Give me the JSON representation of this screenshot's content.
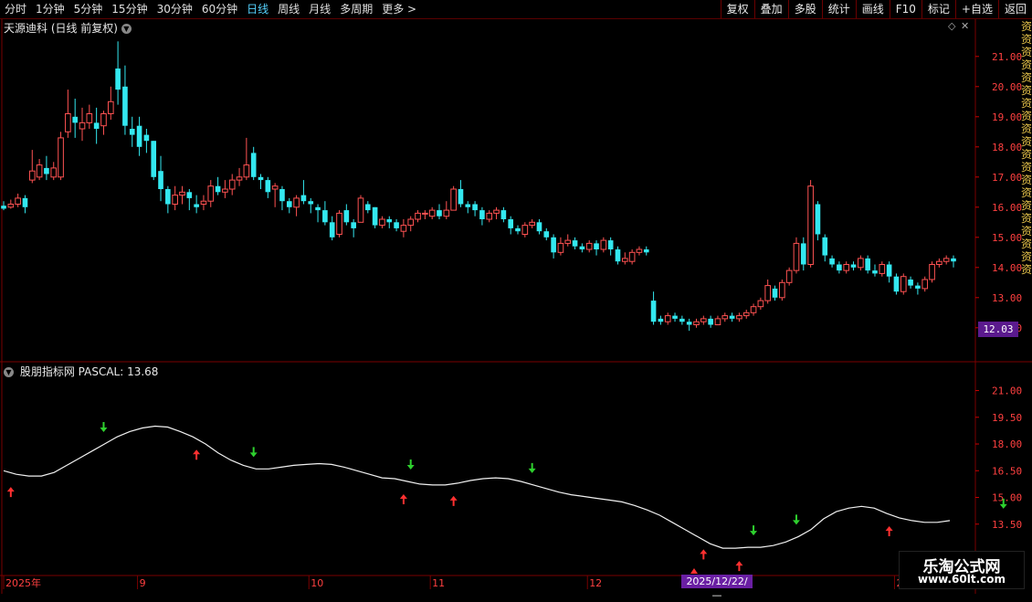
{
  "periods": [
    "分时",
    "1分钟",
    "5分钟",
    "15分钟",
    "30分钟",
    "60分钟",
    "日线",
    "周线",
    "月线",
    "多周期",
    "更多 >"
  ],
  "active_period": "日线",
  "tools": [
    "复权",
    "叠加",
    "多股",
    "统计",
    "画线",
    "F10",
    "标记",
    "+自选",
    "返回"
  ],
  "stock_title": "天源迪科 (日线 前复权)",
  "indicator_title": "股朋指标网 PASCAL: 13.68",
  "right_strip": "资资资资资资资资资资资资资资资资资资资资",
  "current_price": "12.03",
  "cursor_date": "2025/12/22/—",
  "watermark": {
    "line1": "乐淘公式网",
    "line2": "www.60lt.com"
  },
  "main_axis": {
    "min": 11.6,
    "max": 21.6,
    "ticks": [
      "21.00",
      "20.00",
      "19.00",
      "18.00",
      "17.00",
      "16.00",
      "15.00",
      "14.00",
      "13.00",
      "12.00"
    ]
  },
  "ind_axis": {
    "min": 12.0,
    "max": 21.9,
    "ticks": [
      "21.00",
      "19.50",
      "18.00",
      "16.50",
      "15.00",
      "13.50"
    ]
  },
  "x_labels": [
    {
      "text": "2025年",
      "i": 0
    },
    {
      "text": "9",
      "i": 24
    },
    {
      "text": "10",
      "i": 53
    },
    {
      "text": "11",
      "i": 75
    },
    {
      "text": "12",
      "i": 101
    },
    {
      "text": "2",
      "i": 155
    }
  ],
  "colors": {
    "up": "#ff5252",
    "down": "#33e8f0",
    "line": "#f0f0f0",
    "buy": "#ff3030",
    "sell": "#2ed02e",
    "grid": "#7a0000"
  },
  "chart_data": {
    "type": "candlestick",
    "candles": [
      [
        16.05,
        15.95,
        16.2,
        15.9
      ],
      [
        16.0,
        16.1,
        16.25,
        15.95
      ],
      [
        16.1,
        16.3,
        16.45,
        16.0
      ],
      [
        16.3,
        16.0,
        16.4,
        15.8
      ],
      [
        16.9,
        17.2,
        17.9,
        16.8
      ],
      [
        17.0,
        17.4,
        17.6,
        16.9
      ],
      [
        17.3,
        17.1,
        17.7,
        16.9
      ],
      [
        17.0,
        17.3,
        17.5,
        16.9
      ],
      [
        17.0,
        18.3,
        18.5,
        16.9
      ],
      [
        18.5,
        19.1,
        19.9,
        18.3
      ],
      [
        19.0,
        18.8,
        19.6,
        18.3
      ],
      [
        18.6,
        18.8,
        19.3,
        18.2
      ],
      [
        18.8,
        19.1,
        19.4,
        18.6
      ],
      [
        18.8,
        18.6,
        19.3,
        18.1
      ],
      [
        18.7,
        19.1,
        19.2,
        18.4
      ],
      [
        19.1,
        19.5,
        20.0,
        18.9
      ],
      [
        20.6,
        19.9,
        21.5,
        19.4
      ],
      [
        20.0,
        18.7,
        20.7,
        18.4
      ],
      [
        18.6,
        18.4,
        19.0,
        18.0
      ],
      [
        18.7,
        18.0,
        19.0,
        17.7
      ],
      [
        18.4,
        18.2,
        18.6,
        17.8
      ],
      [
        18.2,
        17.0,
        18.2,
        16.9
      ],
      [
        17.2,
        16.6,
        17.7,
        16.2
      ],
      [
        16.6,
        16.1,
        16.7,
        15.8
      ],
      [
        16.1,
        16.4,
        16.7,
        15.9
      ],
      [
        16.4,
        16.5,
        16.7,
        16.1
      ],
      [
        16.5,
        16.3,
        16.6,
        15.9
      ],
      [
        16.1,
        16.0,
        16.4,
        15.8
      ],
      [
        16.1,
        16.2,
        16.4,
        15.9
      ],
      [
        16.2,
        16.7,
        16.9,
        16.0
      ],
      [
        16.7,
        16.5,
        17.0,
        16.4
      ],
      [
        16.5,
        16.6,
        16.9,
        16.3
      ],
      [
        16.6,
        16.9,
        17.1,
        16.4
      ],
      [
        16.9,
        17.0,
        17.3,
        16.7
      ],
      [
        17.0,
        17.4,
        18.3,
        16.9
      ],
      [
        17.8,
        17.0,
        18.0,
        16.9
      ],
      [
        17.0,
        16.9,
        17.1,
        16.6
      ],
      [
        16.9,
        16.5,
        17.0,
        16.3
      ],
      [
        16.6,
        16.7,
        16.8,
        16.0
      ],
      [
        16.6,
        16.2,
        16.7,
        15.9
      ],
      [
        16.2,
        16.0,
        16.3,
        15.8
      ],
      [
        16.0,
        16.3,
        16.4,
        15.7
      ],
      [
        16.4,
        16.2,
        16.9,
        16.1
      ],
      [
        16.2,
        16.1,
        16.3,
        15.8
      ],
      [
        16.0,
        15.9,
        16.1,
        15.5
      ],
      [
        15.9,
        15.5,
        16.2,
        15.4
      ],
      [
        15.5,
        15.0,
        15.7,
        14.9
      ],
      [
        15.1,
        15.8,
        15.9,
        15.0
      ],
      [
        15.9,
        15.5,
        16.1,
        15.4
      ],
      [
        15.5,
        15.3,
        15.6,
        15.0
      ],
      [
        15.5,
        16.3,
        16.4,
        15.5
      ],
      [
        16.1,
        15.9,
        16.2,
        15.8
      ],
      [
        16.0,
        15.4,
        16.0,
        15.3
      ],
      [
        15.4,
        15.6,
        15.7,
        15.3
      ],
      [
        15.6,
        15.5,
        15.7,
        15.3
      ],
      [
        15.5,
        15.3,
        15.6,
        15.2
      ],
      [
        15.2,
        15.4,
        15.6,
        15.0
      ],
      [
        15.4,
        15.6,
        15.7,
        15.2
      ],
      [
        15.6,
        15.8,
        15.9,
        15.5
      ],
      [
        15.8,
        15.8,
        15.9,
        15.6
      ],
      [
        15.7,
        15.9,
        16.0,
        15.6
      ],
      [
        15.9,
        15.7,
        16.1,
        15.6
      ],
      [
        15.7,
        15.9,
        16.2,
        15.6
      ],
      [
        15.9,
        16.6,
        16.7,
        15.9
      ],
      [
        16.6,
        16.1,
        16.9,
        16.0
      ],
      [
        16.1,
        16.0,
        16.2,
        15.8
      ],
      [
        16.1,
        15.9,
        16.2,
        15.7
      ],
      [
        15.9,
        15.6,
        16.0,
        15.4
      ],
      [
        15.6,
        15.8,
        15.9,
        15.5
      ],
      [
        15.8,
        15.9,
        16.0,
        15.6
      ],
      [
        15.9,
        15.6,
        16.0,
        15.5
      ],
      [
        15.6,
        15.3,
        15.7,
        15.1
      ],
      [
        15.3,
        15.2,
        15.4,
        15.1
      ],
      [
        15.1,
        15.4,
        15.5,
        15.0
      ],
      [
        15.4,
        15.5,
        15.6,
        15.3
      ],
      [
        15.5,
        15.2,
        15.6,
        15.1
      ],
      [
        15.2,
        15.0,
        15.3,
        14.9
      ],
      [
        15.0,
        14.5,
        15.1,
        14.3
      ],
      [
        14.5,
        14.8,
        15.0,
        14.4
      ],
      [
        14.8,
        14.9,
        15.1,
        14.7
      ],
      [
        14.9,
        14.7,
        15.0,
        14.6
      ],
      [
        14.7,
        14.6,
        14.8,
        14.5
      ],
      [
        14.6,
        14.8,
        14.9,
        14.5
      ],
      [
        14.8,
        14.6,
        14.9,
        14.4
      ],
      [
        14.6,
        14.9,
        15.0,
        14.5
      ],
      [
        14.9,
        14.6,
        15.0,
        14.4
      ],
      [
        14.6,
        14.2,
        14.7,
        14.1
      ],
      [
        14.2,
        14.3,
        14.5,
        14.1
      ],
      [
        14.2,
        14.5,
        14.6,
        14.1
      ],
      [
        14.5,
        14.6,
        14.7,
        14.4
      ],
      [
        14.6,
        14.5,
        14.7,
        14.4
      ],
      [
        12.9,
        12.2,
        13.2,
        12.1
      ],
      [
        12.3,
        12.2,
        12.4,
        12.1
      ],
      [
        12.2,
        12.4,
        12.5,
        12.1
      ],
      [
        12.4,
        12.3,
        12.5,
        12.2
      ],
      [
        12.3,
        12.2,
        12.4,
        12.1
      ],
      [
        12.2,
        12.1,
        12.3,
        11.9
      ],
      [
        12.1,
        12.2,
        12.3,
        12.0
      ],
      [
        12.2,
        12.3,
        12.4,
        12.1
      ],
      [
        12.3,
        12.1,
        12.4,
        12.0
      ],
      [
        12.1,
        12.3,
        12.4,
        12.1
      ],
      [
        12.3,
        12.4,
        12.5,
        12.2
      ],
      [
        12.4,
        12.3,
        12.5,
        12.2
      ],
      [
        12.3,
        12.4,
        12.5,
        12.2
      ],
      [
        12.4,
        12.5,
        12.6,
        12.3
      ],
      [
        12.5,
        12.7,
        12.8,
        12.4
      ],
      [
        12.7,
        12.9,
        13.0,
        12.6
      ],
      [
        12.9,
        13.4,
        13.6,
        12.8
      ],
      [
        13.3,
        13.0,
        13.4,
        12.9
      ],
      [
        13.0,
        13.5,
        13.6,
        12.9
      ],
      [
        13.5,
        13.9,
        14.0,
        13.4
      ],
      [
        13.9,
        14.8,
        15.0,
        13.8
      ],
      [
        14.8,
        14.1,
        15.0,
        13.9
      ],
      [
        14.1,
        16.7,
        16.9,
        14.0
      ],
      [
        16.1,
        15.1,
        16.2,
        14.9
      ],
      [
        15.0,
        14.4,
        15.1,
        14.2
      ],
      [
        14.3,
        14.1,
        14.4,
        14.0
      ],
      [
        14.1,
        13.9,
        14.2,
        13.8
      ],
      [
        13.9,
        14.1,
        14.2,
        13.8
      ],
      [
        14.1,
        14.0,
        14.2,
        13.9
      ],
      [
        14.0,
        14.3,
        14.4,
        13.9
      ],
      [
        14.3,
        13.9,
        14.4,
        13.8
      ],
      [
        13.9,
        13.8,
        14.1,
        13.7
      ],
      [
        13.8,
        14.1,
        14.2,
        13.7
      ],
      [
        14.1,
        13.7,
        14.2,
        13.5
      ],
      [
        13.7,
        13.2,
        13.8,
        13.1
      ],
      [
        13.2,
        13.7,
        13.8,
        13.1
      ],
      [
        13.6,
        13.4,
        13.7,
        13.3
      ],
      [
        13.4,
        13.3,
        13.5,
        13.1
      ],
      [
        13.3,
        13.6,
        13.7,
        13.2
      ],
      [
        13.6,
        14.1,
        14.2,
        13.5
      ],
      [
        14.1,
        14.2,
        14.3,
        14.0
      ],
      [
        14.2,
        14.3,
        14.4,
        14.1
      ],
      [
        14.3,
        14.2,
        14.4,
        14.0
      ]
    ],
    "pascal": [
      16.5,
      16.3,
      16.2,
      16.2,
      16.4,
      16.8,
      17.2,
      17.6,
      18.0,
      18.4,
      18.7,
      18.9,
      19.0,
      18.95,
      18.7,
      18.4,
      18.0,
      17.5,
      17.1,
      16.8,
      16.6,
      16.6,
      16.7,
      16.8,
      16.85,
      16.9,
      16.85,
      16.7,
      16.5,
      16.3,
      16.1,
      16.05,
      15.9,
      15.75,
      15.7,
      15.7,
      15.8,
      15.95,
      16.05,
      16.1,
      16.05,
      15.9,
      15.7,
      15.5,
      15.3,
      15.15,
      15.05,
      14.95,
      14.85,
      14.75,
      14.55,
      14.3,
      14.0,
      13.6,
      13.2,
      12.8,
      12.4,
      12.15,
      12.15,
      12.2,
      12.2,
      12.3,
      12.5,
      12.8,
      13.2,
      13.8,
      14.2,
      14.4,
      14.5,
      14.4,
      14.1,
      13.85,
      13.7,
      13.6,
      13.6,
      13.7
    ],
    "signals": [
      {
        "k": 1,
        "t": "buy"
      },
      {
        "k": 14,
        "t": "sell"
      },
      {
        "k": 27,
        "t": "buy"
      },
      {
        "k": 35,
        "t": "sell"
      },
      {
        "k": 56,
        "t": "buy"
      },
      {
        "k": 57,
        "t": "sell"
      },
      {
        "k": 63,
        "t": "buy"
      },
      {
        "k": 74,
        "t": "sell"
      },
      {
        "k": 98,
        "t": "buy"
      },
      {
        "k": 103,
        "t": "buy"
      },
      {
        "k": 105,
        "t": "sell"
      },
      {
        "k": 111,
        "t": "sell"
      },
      {
        "k": 124,
        "t": "buy"
      },
      {
        "k": 140,
        "t": "sell"
      },
      {
        "k": 158,
        "t": "buy"
      }
    ]
  }
}
